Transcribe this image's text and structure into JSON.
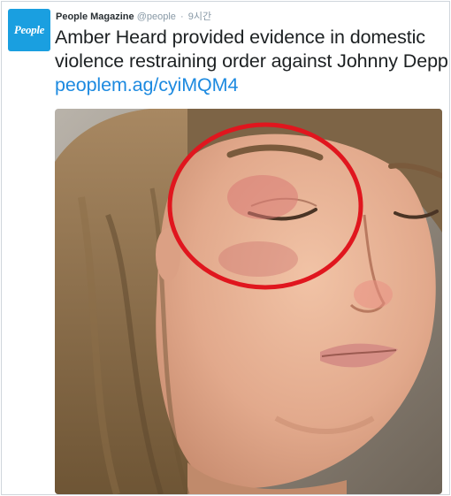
{
  "tweet": {
    "avatar_text": "People",
    "author_name": "People Magazine",
    "handle": "@people",
    "separator": "·",
    "timestamp": "9시간",
    "text": "Amber Heard provided evidence in domestic violence restraining order against Johnny Depp",
    "link": "peoplem.ag/cyiMQM4"
  },
  "media": {
    "annotation_color": "#e0161e"
  }
}
